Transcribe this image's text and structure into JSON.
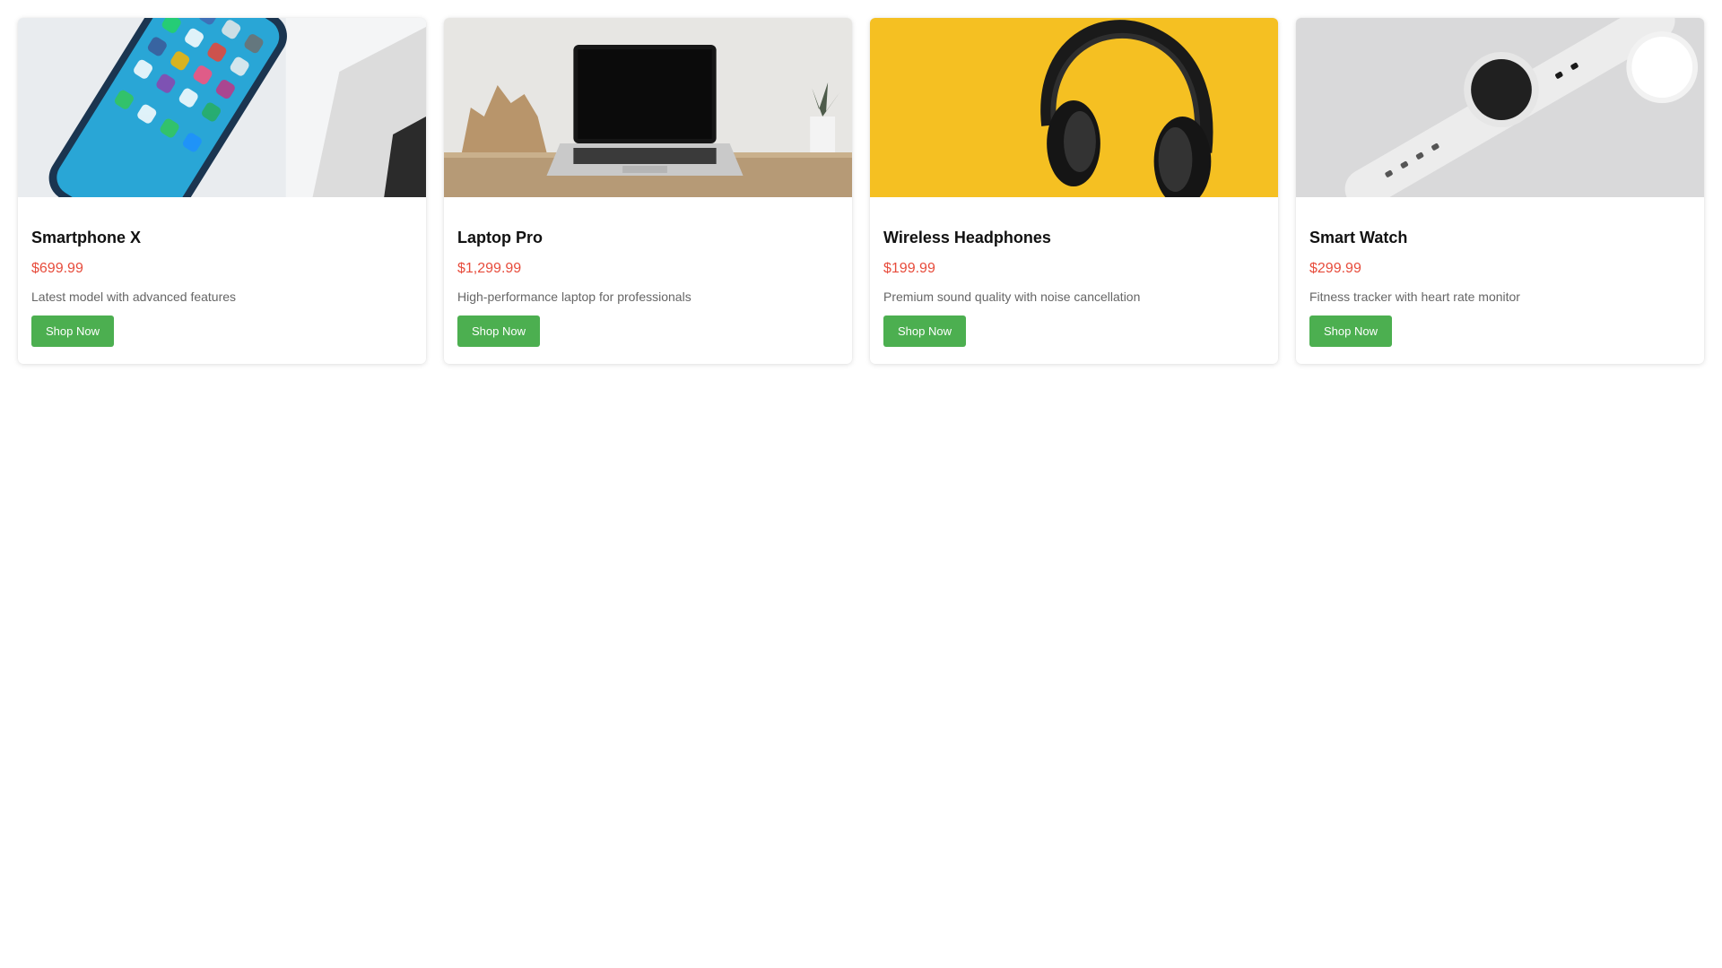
{
  "products": [
    {
      "name": "Smartphone X",
      "price": "$699.99",
      "description": "Latest model with advanced features",
      "button_label": "Shop Now",
      "image": "smartphone-photo"
    },
    {
      "name": "Laptop Pro",
      "price": "$1,299.99",
      "description": "High-performance laptop for professionals",
      "button_label": "Shop Now",
      "image": "laptop-photo"
    },
    {
      "name": "Wireless Headphones",
      "price": "$199.99",
      "description": "Premium sound quality with noise cancellation",
      "button_label": "Shop Now",
      "image": "headphones-photo"
    },
    {
      "name": "Smart Watch",
      "price": "$299.99",
      "description": "Fitness tracker with heart rate monitor",
      "button_label": "Shop Now",
      "image": "smartwatch-photo"
    }
  ],
  "colors": {
    "price": "#e74c3c",
    "button": "#4caf50",
    "description": "#666666"
  }
}
